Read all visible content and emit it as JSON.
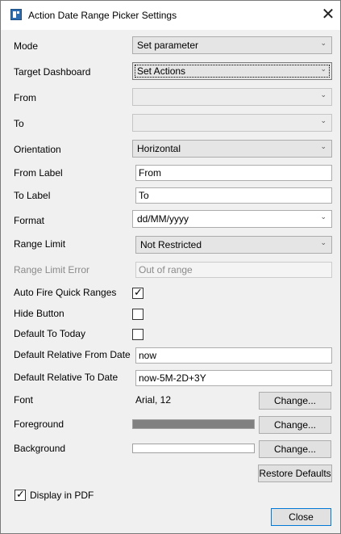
{
  "window": {
    "title": "Action Date Range Picker Settings"
  },
  "fields": {
    "mode": {
      "label": "Mode",
      "value": "Set parameter"
    },
    "target_dashboard": {
      "label": "Target Dashboard",
      "value": "Set Actions"
    },
    "from": {
      "label": "From",
      "value": ""
    },
    "to": {
      "label": "To",
      "value": ""
    },
    "orientation": {
      "label": "Orientation",
      "value": "Horizontal"
    },
    "from_label": {
      "label": "From Label",
      "value": "From"
    },
    "to_label": {
      "label": "To Label",
      "value": "To"
    },
    "format": {
      "label": "Format",
      "value": "dd/MM/yyyy"
    },
    "range_limit": {
      "label": "Range Limit",
      "value": "Not Restricted"
    },
    "range_limit_error": {
      "label": "Range Limit Error",
      "value": "Out of range"
    },
    "auto_fire_quick_ranges": {
      "label": "Auto Fire Quick Ranges",
      "checked": true
    },
    "hide_button": {
      "label": "Hide Button",
      "checked": false
    },
    "default_to_today": {
      "label": "Default To Today",
      "checked": false
    },
    "default_relative_from_date": {
      "label": "Default Relative From Date",
      "value": "now"
    },
    "default_relative_to_date": {
      "label": "Default Relative To Date",
      "value": "now-5M-2D+3Y"
    },
    "font": {
      "label": "Font",
      "value": "Arial, 12",
      "button": "Change..."
    },
    "foreground": {
      "label": "Foreground",
      "color": "#808080",
      "button": "Change..."
    },
    "background": {
      "label": "Background",
      "color": "#ffffff",
      "button": "Change..."
    }
  },
  "buttons": {
    "restore_defaults": "Restore Defaults",
    "close": "Close"
  },
  "display_in_pdf": {
    "label": "Display in PDF",
    "checked": true
  },
  "icons": {
    "dropdown": "chevron-down-icon",
    "check": "check-icon",
    "close": "close-icon"
  }
}
